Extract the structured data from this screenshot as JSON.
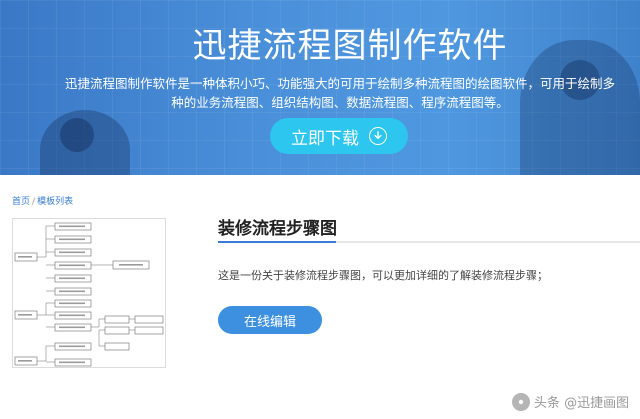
{
  "banner": {
    "title": "迅捷流程图制作软件",
    "description": "迅捷流程图制作软件是一种体积小巧、功能强大的可用于绘制多种流程图的绘图软件，可用于绘制多种的业务流程图、组织结构图、数据流程图、程序流程图等。",
    "download_label": "立即下载",
    "download_icon": "download-arrow-icon"
  },
  "breadcrumb": {
    "home": "首页",
    "separator": "/",
    "current": "模板列表"
  },
  "template": {
    "title": "装修流程步骤图",
    "description": "这是一份关于装修流程步骤图，可以更加详细的了解装修流程步骤；",
    "edit_label": "在线编辑"
  },
  "watermark": {
    "text": "头条 @迅捷画图"
  },
  "colors": {
    "banner": "#4a8fd9",
    "download_button": "#2cc6ee",
    "edit_button": "#3d8fe0",
    "accent": "#3a7bd5"
  }
}
